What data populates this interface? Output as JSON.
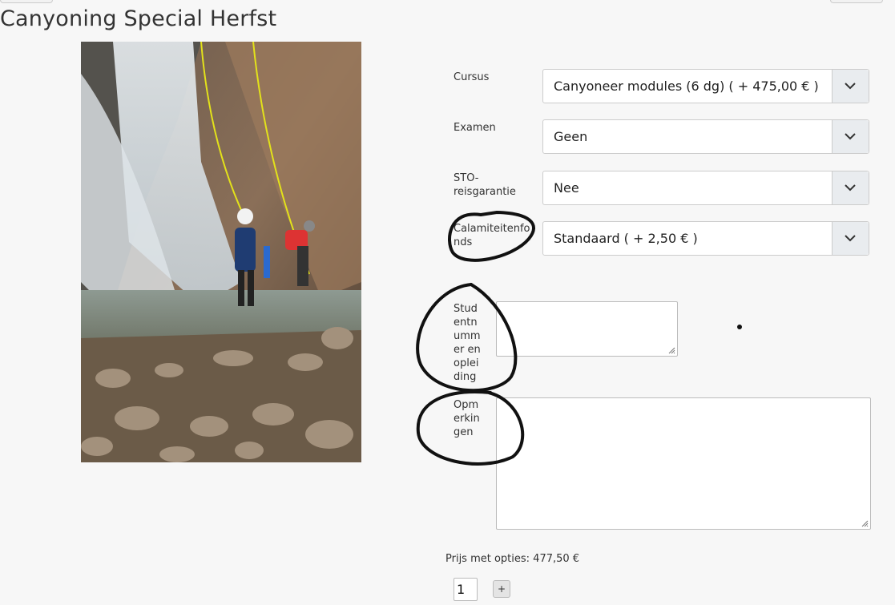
{
  "page": {
    "title": "Canyoning Special Herfst"
  },
  "form": {
    "cursus": {
      "label": "Cursus",
      "value": "Canyoneer modules (6 dg) ( + 475,00 € )"
    },
    "examen": {
      "label": "Examen",
      "value": "Geen"
    },
    "sto": {
      "label": "STO-reisgarantie",
      "value": "Nee"
    },
    "calamiteiten": {
      "label": "Calamiteitenfonds",
      "value": "Standaard ( + 2,50 € )"
    },
    "studentnummer": {
      "label": "Studentnummer en opleiding",
      "value": ""
    },
    "opmerkingen": {
      "label": "Opmerkingen",
      "value": ""
    }
  },
  "price": {
    "text": "Prijs met opties: 477,50 €"
  },
  "quantity": {
    "value": "1"
  },
  "add_button": {
    "label": "+"
  },
  "colors": {
    "annotation": "#111111",
    "select_arrow_bg": "#e9ecef",
    "background": "#f7f7f7"
  },
  "icons": {
    "select_arrow": "chevron-down-icon",
    "resize": "resize-grip-icon"
  }
}
